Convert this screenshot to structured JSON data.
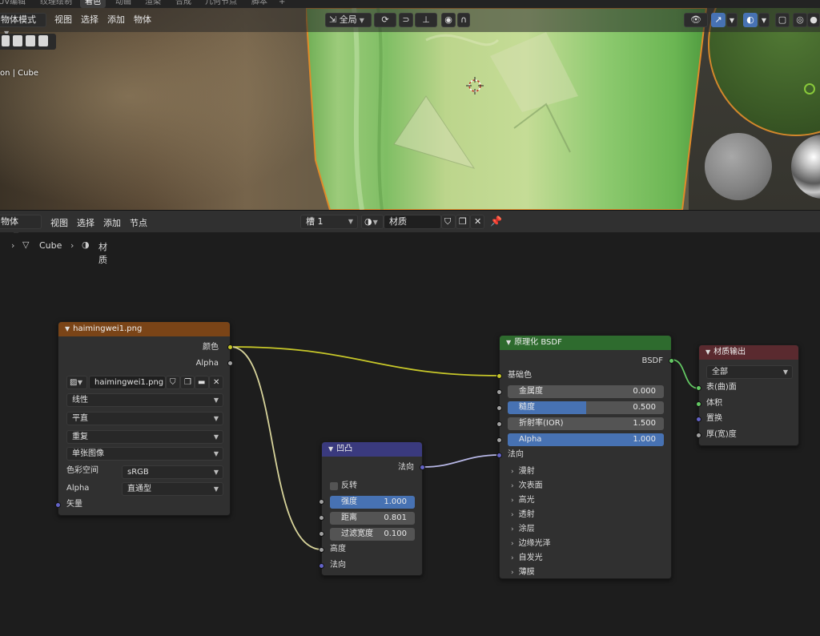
{
  "workspace_tabs": [
    "UV编辑",
    "纹理绘制",
    "着色",
    "动画",
    "渲染",
    "合成",
    "几何节点",
    "脚本",
    "+"
  ],
  "viewport": {
    "mode_label": "物体模式",
    "menus": [
      "视图",
      "选择",
      "添加",
      "物体"
    ],
    "orientation_label": "全局",
    "info_text": "on | Cube"
  },
  "node_editor": {
    "type_label": "物体",
    "menus": [
      "视图",
      "选择",
      "添加",
      "节点"
    ],
    "slot_label": "槽 1",
    "material_name": "材质",
    "breadcrumb": {
      "object": "Cube",
      "material": "材质"
    }
  },
  "image_node": {
    "title": "haimingwei1.png",
    "outputs": [
      "颜色",
      "Alpha"
    ],
    "image_name": "haimingwei1.png",
    "interpolation": "线性",
    "projection": "平直",
    "extension": "重复",
    "source": "单张图像",
    "colorspace_label": "色彩空间",
    "colorspace_value": "sRGB",
    "alpha_label": "Alpha",
    "alpha_value": "直通型",
    "vector_input": "矢量"
  },
  "bump_node": {
    "title": "凹凸",
    "output": "法向",
    "invert_label": "反转",
    "strength": {
      "label": "强度",
      "value": "1.000",
      "level": 1.0
    },
    "distance": {
      "label": "距离",
      "value": "0.801"
    },
    "filter_width": {
      "label": "过滤宽度",
      "value": "0.100"
    },
    "height_input": "高度",
    "normal_input": "法向"
  },
  "bsdf_node": {
    "title": "原理化 BSDF",
    "output": "BSDF",
    "base_color": "基础色",
    "metallic": {
      "label": "金属度",
      "value": "0.000",
      "level": 0.0
    },
    "roughness": {
      "label": "糙度",
      "value": "0.500",
      "level": 0.5
    },
    "ior": {
      "label": "折射率(IOR)",
      "value": "1.500"
    },
    "alpha": {
      "label": "Alpha",
      "value": "1.000",
      "level": 1.0
    },
    "normal": "法向",
    "panels": [
      "漫射",
      "次表面",
      "高光",
      "透射",
      "涂层",
      "边缘光泽",
      "自发光",
      "薄膜"
    ]
  },
  "output_node": {
    "title": "材质输出",
    "target": "全部",
    "inputs": [
      "表(曲)面",
      "体积",
      "置换",
      "厚(宽)度"
    ]
  },
  "colors": {
    "image_header": "#7a4417",
    "bump_header": "#3a3a7e",
    "bsdf_header": "#2e6b2e",
    "output_header": "#5a2a2f",
    "accent_blue": "#4772b3"
  }
}
